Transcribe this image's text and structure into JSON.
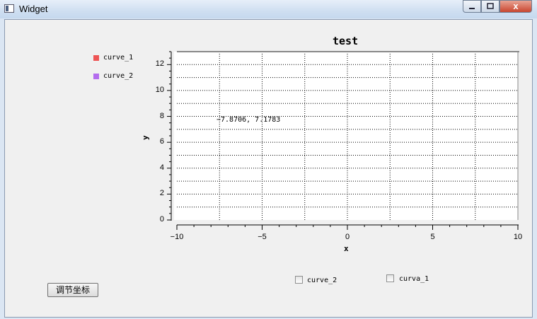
{
  "window": {
    "title": "Widget",
    "close_glyph": "x"
  },
  "legend": [
    {
      "label": "curve_1",
      "color": "#ee5555"
    },
    {
      "label": "curve_2",
      "color": "#b36cee"
    }
  ],
  "chart_data": {
    "type": "line",
    "title": "test",
    "xlabel": "x",
    "ylabel": "y",
    "xlim": [
      -10,
      10
    ],
    "ylim": [
      0,
      13
    ],
    "x_ticks": [
      "−10",
      "−5",
      "0",
      "5",
      "10"
    ],
    "y_ticks": [
      "0",
      "2",
      "4",
      "6",
      "8",
      "10",
      "12"
    ],
    "grid": true,
    "series": [
      {
        "name": "curve_1",
        "color": "#ee5555",
        "x": [],
        "y": []
      },
      {
        "name": "curve_2",
        "color": "#b36cee",
        "x": [],
        "y": []
      }
    ]
  },
  "coord_readout": "−7.8706, 7.1783",
  "button": {
    "label": "调节坐标"
  },
  "checkboxes": [
    {
      "label": "curve_2",
      "checked": false
    },
    {
      "label": "curva_1",
      "checked": false
    }
  ]
}
